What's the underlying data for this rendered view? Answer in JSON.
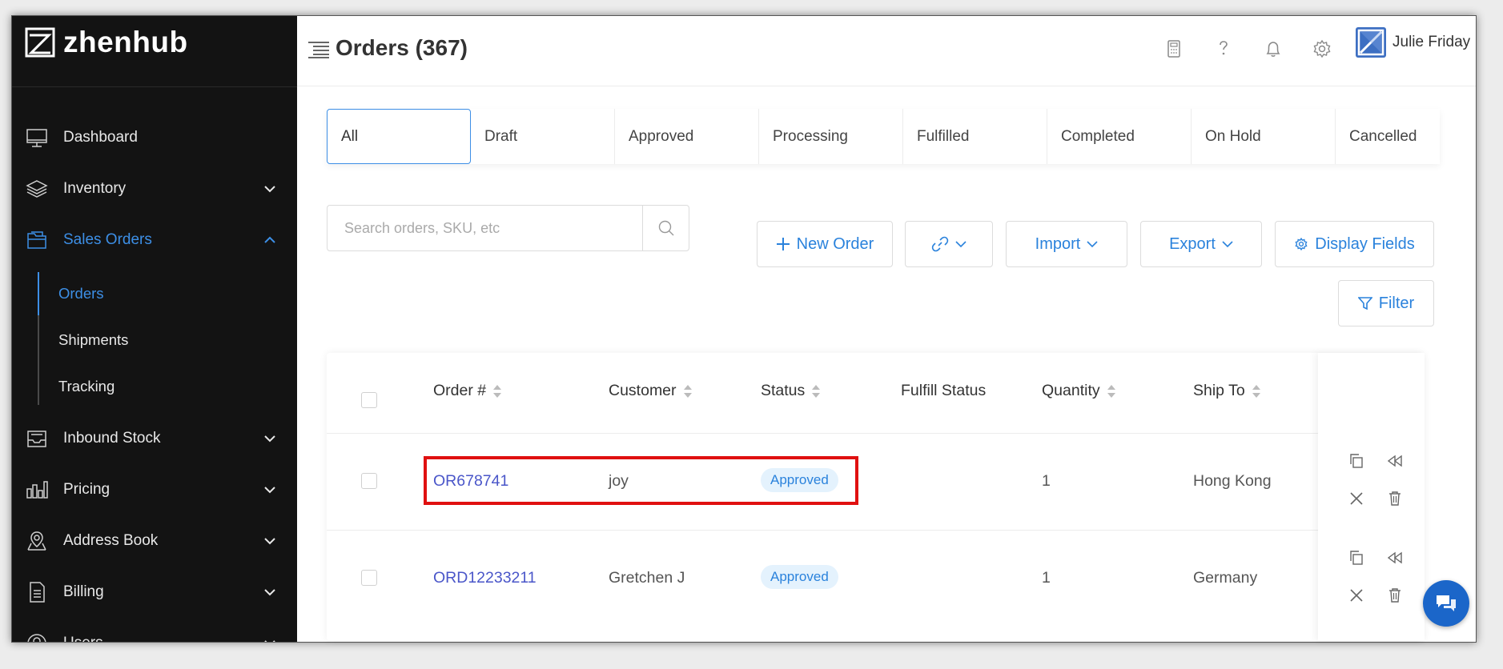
{
  "brand": {
    "name": "zhenhub"
  },
  "sidebar": {
    "items": [
      {
        "label": "Dashboard",
        "icon": "monitor-icon"
      },
      {
        "label": "Inventory",
        "icon": "layers-icon"
      },
      {
        "label": "Sales Orders",
        "icon": "folder-icon",
        "active": true
      },
      {
        "label": "Inbound Stock",
        "icon": "inbox-icon"
      },
      {
        "label": "Pricing",
        "icon": "bar-chart-icon"
      },
      {
        "label": "Address Book",
        "icon": "map-pin-icon"
      },
      {
        "label": "Billing",
        "icon": "document-icon"
      },
      {
        "label": "Users",
        "icon": "user-icon"
      }
    ],
    "sub_items": [
      {
        "label": "Orders",
        "active": true
      },
      {
        "label": "Shipments"
      },
      {
        "label": "Tracking"
      }
    ]
  },
  "header": {
    "title": "Orders (367)",
    "user_name": "Julie Friday"
  },
  "tabs": [
    "All",
    "Draft",
    "Approved",
    "Processing",
    "Fulfilled",
    "Completed",
    "On Hold",
    "Cancelled"
  ],
  "toolbar": {
    "search_placeholder": "Search orders, SKU, etc",
    "new_order": "New Order",
    "import": "Import",
    "export": "Export",
    "display_fields": "Display Fields",
    "filter": "Filter"
  },
  "table": {
    "columns": [
      "Order #",
      "Customer",
      "Status",
      "Fulfill Status",
      "Quantity",
      "Ship To"
    ],
    "rows": [
      {
        "order": "OR678741",
        "customer": "joy",
        "status": "Approved",
        "fulfill_status": "",
        "quantity": "1",
        "ship_to": "Hong Kong"
      },
      {
        "order": "ORD12233211",
        "customer": "Gretchen J",
        "status": "Approved",
        "fulfill_status": "",
        "quantity": "1",
        "ship_to": "Germany"
      }
    ]
  },
  "colors": {
    "accent": "#3d8fe6",
    "link": "#4a56c9",
    "sidebar_bg": "#131313",
    "highlight": "#e01010",
    "badge_bg": "#e4f2fd"
  }
}
